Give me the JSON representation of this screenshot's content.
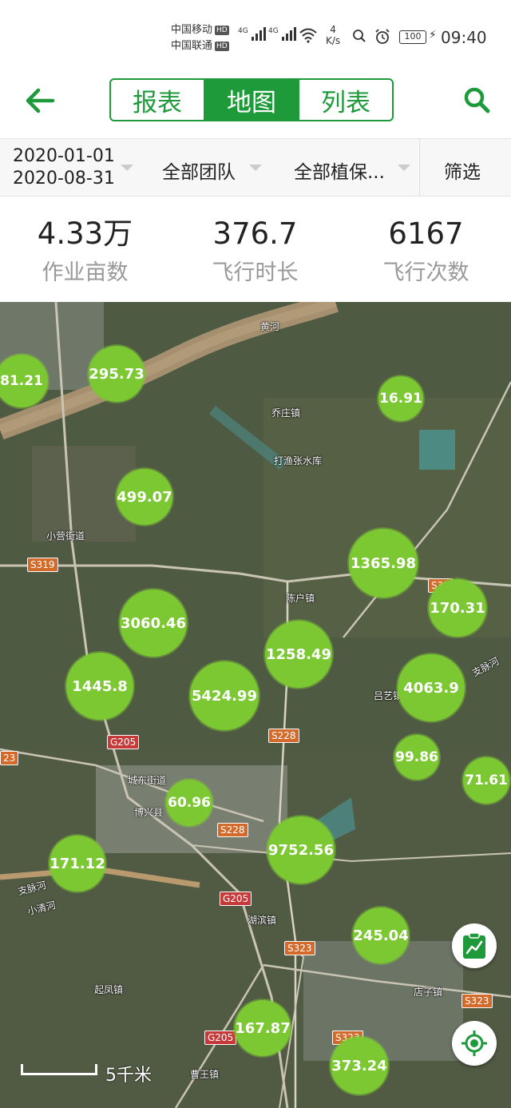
{
  "status_bar": {
    "carrier1": "中国移动",
    "carrier2": "中国联通",
    "hd": "HD",
    "net_type": "4G",
    "speed_value": "4",
    "speed_unit": "K/s",
    "battery": "100",
    "time": "09:40"
  },
  "header": {
    "tabs": [
      {
        "label": "报表",
        "active": false
      },
      {
        "label": "地图",
        "active": true
      },
      {
        "label": "列表",
        "active": false
      }
    ],
    "accent_color": "#1e9a3a"
  },
  "filters": {
    "date_start": "2020-01-01",
    "date_end": "2020-08-31",
    "team": "全部团队",
    "plant": "全部植保...",
    "filter_label": "筛选"
  },
  "stats": [
    {
      "value": "4.33万",
      "label": "作业亩数"
    },
    {
      "value": "376.7",
      "label": "飞行时长"
    },
    {
      "value": "6167",
      "label": "飞行次数"
    }
  ],
  "map": {
    "places": [
      "黄河",
      "乔庄镇",
      "打渔张水库",
      "小营街道",
      "陈户镇",
      "吕艺镇",
      "支脉河",
      "城东街道",
      "博兴县",
      "湖滨镇",
      "起凤镇",
      "店子镇",
      "曹王镇",
      "支脉河",
      "小清河"
    ],
    "roads": [
      "S319",
      "S32",
      "S228",
      "G205",
      "S228",
      "G205",
      "S323",
      "S323",
      "G205",
      "S323",
      "23"
    ],
    "bubbles": [
      "81.21",
      "295.73",
      "16.91",
      "499.07",
      "1365.98",
      "170.31",
      "3060.46",
      "1258.49",
      "1445.8",
      "5424.99",
      "4063.9",
      "99.86",
      "71.61",
      "60.96",
      "9752.56",
      "171.12",
      "245.04",
      "167.87",
      "373.24"
    ],
    "scale_label": "5千米",
    "bubble_color": "#7cc832"
  }
}
